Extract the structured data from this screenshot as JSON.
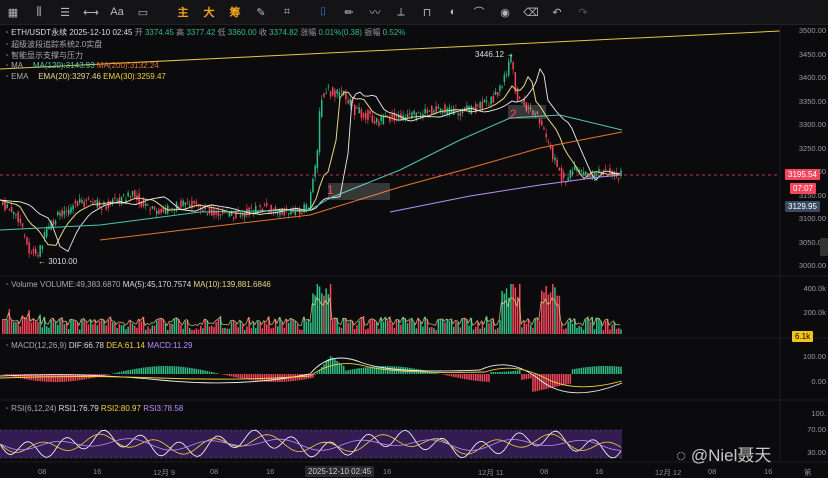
{
  "toolbar": {
    "items": [
      {
        "name": "grid-icon",
        "glyph": "▦"
      },
      {
        "name": "candles-icon",
        "glyph": "⫼"
      },
      {
        "name": "menu-icon",
        "glyph": "☰"
      },
      {
        "name": "line-tool-icon",
        "glyph": "⟷"
      },
      {
        "name": "text-tool",
        "glyph": "Aa"
      },
      {
        "name": "layout-icon",
        "glyph": "▭"
      }
    ],
    "main_label": "主",
    "big_label": "大",
    "chips_label": "筹",
    "right_tools": [
      {
        "name": "edit-icon",
        "glyph": "✎"
      },
      {
        "name": "select-icon",
        "glyph": "⌗"
      },
      {
        "name": "brush-icon",
        "glyph": "✏"
      },
      {
        "name": "wave-icon",
        "glyph": "〰"
      },
      {
        "name": "ruler-icon",
        "glyph": "⟂"
      },
      {
        "name": "lock-icon",
        "glyph": "🔒"
      },
      {
        "name": "hide-icon",
        "glyph": "◐"
      },
      {
        "name": "magnet-icon",
        "glyph": "⌒"
      },
      {
        "name": "eye-icon",
        "glyph": "◉"
      },
      {
        "name": "trash-icon",
        "glyph": "🗑"
      },
      {
        "name": "undo-icon",
        "glyph": "↶"
      },
      {
        "name": "redo-icon",
        "glyph": "↷"
      }
    ]
  },
  "header": {
    "symbol": "ETH/USDT永续",
    "datetime": "2025-12-10 02:45",
    "open_label": "开",
    "open": "3374.45",
    "high_label": "高",
    "high": "3377.42",
    "low_label": "低",
    "low": "3360.00",
    "close_label": "收",
    "close": "3374.82",
    "change_label": "涨幅",
    "change": "0.01%(0.38)",
    "amp_label": "振幅",
    "amp": "0.52%",
    "line2": "超级波段追踪系统2.0实盘",
    "line3": "智能显示支撑与压力",
    "ma_label": "MA",
    "ma120": "MA(120):3143.93",
    "ma200": "MA(200):3132.24",
    "ema_label": "EMA",
    "ema20": "EMA(20):3297.46",
    "ema30": "EMA(30):3259.47"
  },
  "annotations": {
    "high": "3446.12 →",
    "low": "← 3010.00",
    "box1": "1",
    "box2": "2"
  },
  "price_axis": [
    "3500.00",
    "3450.00",
    "3400.00",
    "3350.00",
    "3300.00",
    "3250.00",
    "3200.00",
    "3150.00",
    "3100.00",
    "3050.00",
    "3000.00"
  ],
  "price_tags": {
    "current": "3195.54",
    "countdown": "07:07",
    "ma_tag": "3129.95"
  },
  "volume": {
    "title": "Volume",
    "volume": "VOLUME:49,383.6870",
    "ma5": "MA(5):45,170.7574",
    "ma10": "MA(10):139,881.6846",
    "axis": [
      "400.0k",
      "200.0k"
    ],
    "tag": "6.1k"
  },
  "macd": {
    "title": "MACD(12,26,9)",
    "dif": "DIF:66.78",
    "dea": "DEA:61.14",
    "macd": "MACD:11.29",
    "axis": [
      "100.00",
      "0.00"
    ]
  },
  "rsi": {
    "title": "RSI(6,12,24)",
    "rsi1": "RSI1:76.79",
    "rsi2": "RSI2:80.97",
    "rsi3": "RSI3:78.58",
    "axis": [
      "100.",
      "70.00",
      "30.00"
    ]
  },
  "time_axis": [
    "08",
    "16",
    "12月 9",
    "08",
    "16",
    "08",
    "16",
    "12月 11",
    "08",
    "16",
    "12月 12",
    "08",
    "16",
    "第"
  ],
  "time_cursor": "2025-12-10 02:45",
  "watermark": "@Niel聂天",
  "colors": {
    "up": "#2ebd85",
    "down": "#f6465d",
    "accent": "#f0a21a",
    "blue": "#3f8cff",
    "ma120": "#4cc7b0",
    "ma200": "#e8742c",
    "ema20": "#e8d68a",
    "ema30": "#f2d23c",
    "purple": "#b78fff"
  }
}
